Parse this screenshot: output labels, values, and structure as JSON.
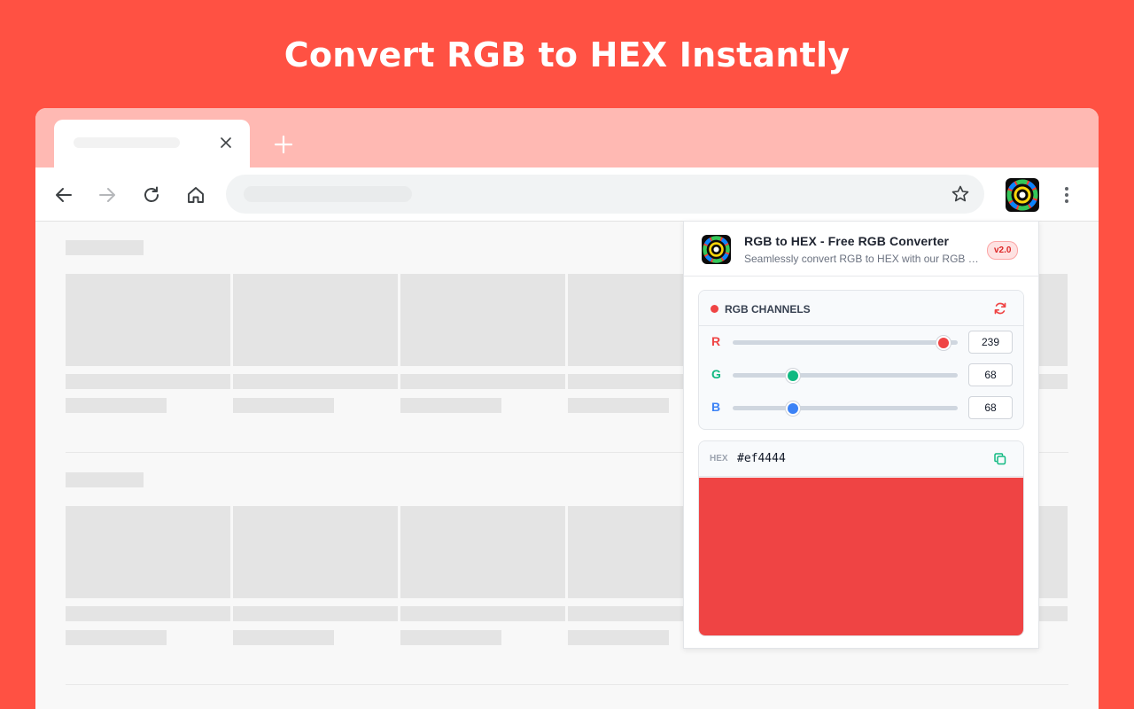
{
  "hero": {
    "title": "Convert RGB to HEX Instantly"
  },
  "extension": {
    "name": "RGB to HEX - Free RGB Converter",
    "description": "Seamlessly convert RGB to HEX with our RGB to HEX converter",
    "version": "v2.0"
  },
  "channels": {
    "title": "RGB CHANNELS",
    "items": [
      {
        "letter": "R",
        "value": "239",
        "level": 239,
        "color": "#ef4444"
      },
      {
        "letter": "G",
        "value": "68",
        "level": 68,
        "color": "#10b981"
      },
      {
        "letter": "B",
        "value": "68",
        "level": 68,
        "color": "#3b82f6"
      }
    ],
    "max": 255
  },
  "hex": {
    "label": "HEX",
    "value": "#ef4444"
  },
  "colors": {
    "background": "#ff5143",
    "tabstrip": "#ffb9b3",
    "swatch": "#ef4444",
    "accent_red": "#ef4444",
    "accent_green": "#10b981"
  },
  "icons": {
    "back": "arrow-left-icon",
    "forward": "arrow-right-icon",
    "reload": "reload-icon",
    "home": "home-icon",
    "bookmark": "star-icon",
    "menu": "kebab-menu-icon",
    "reset": "refresh-icon",
    "copy": "copy-icon"
  }
}
